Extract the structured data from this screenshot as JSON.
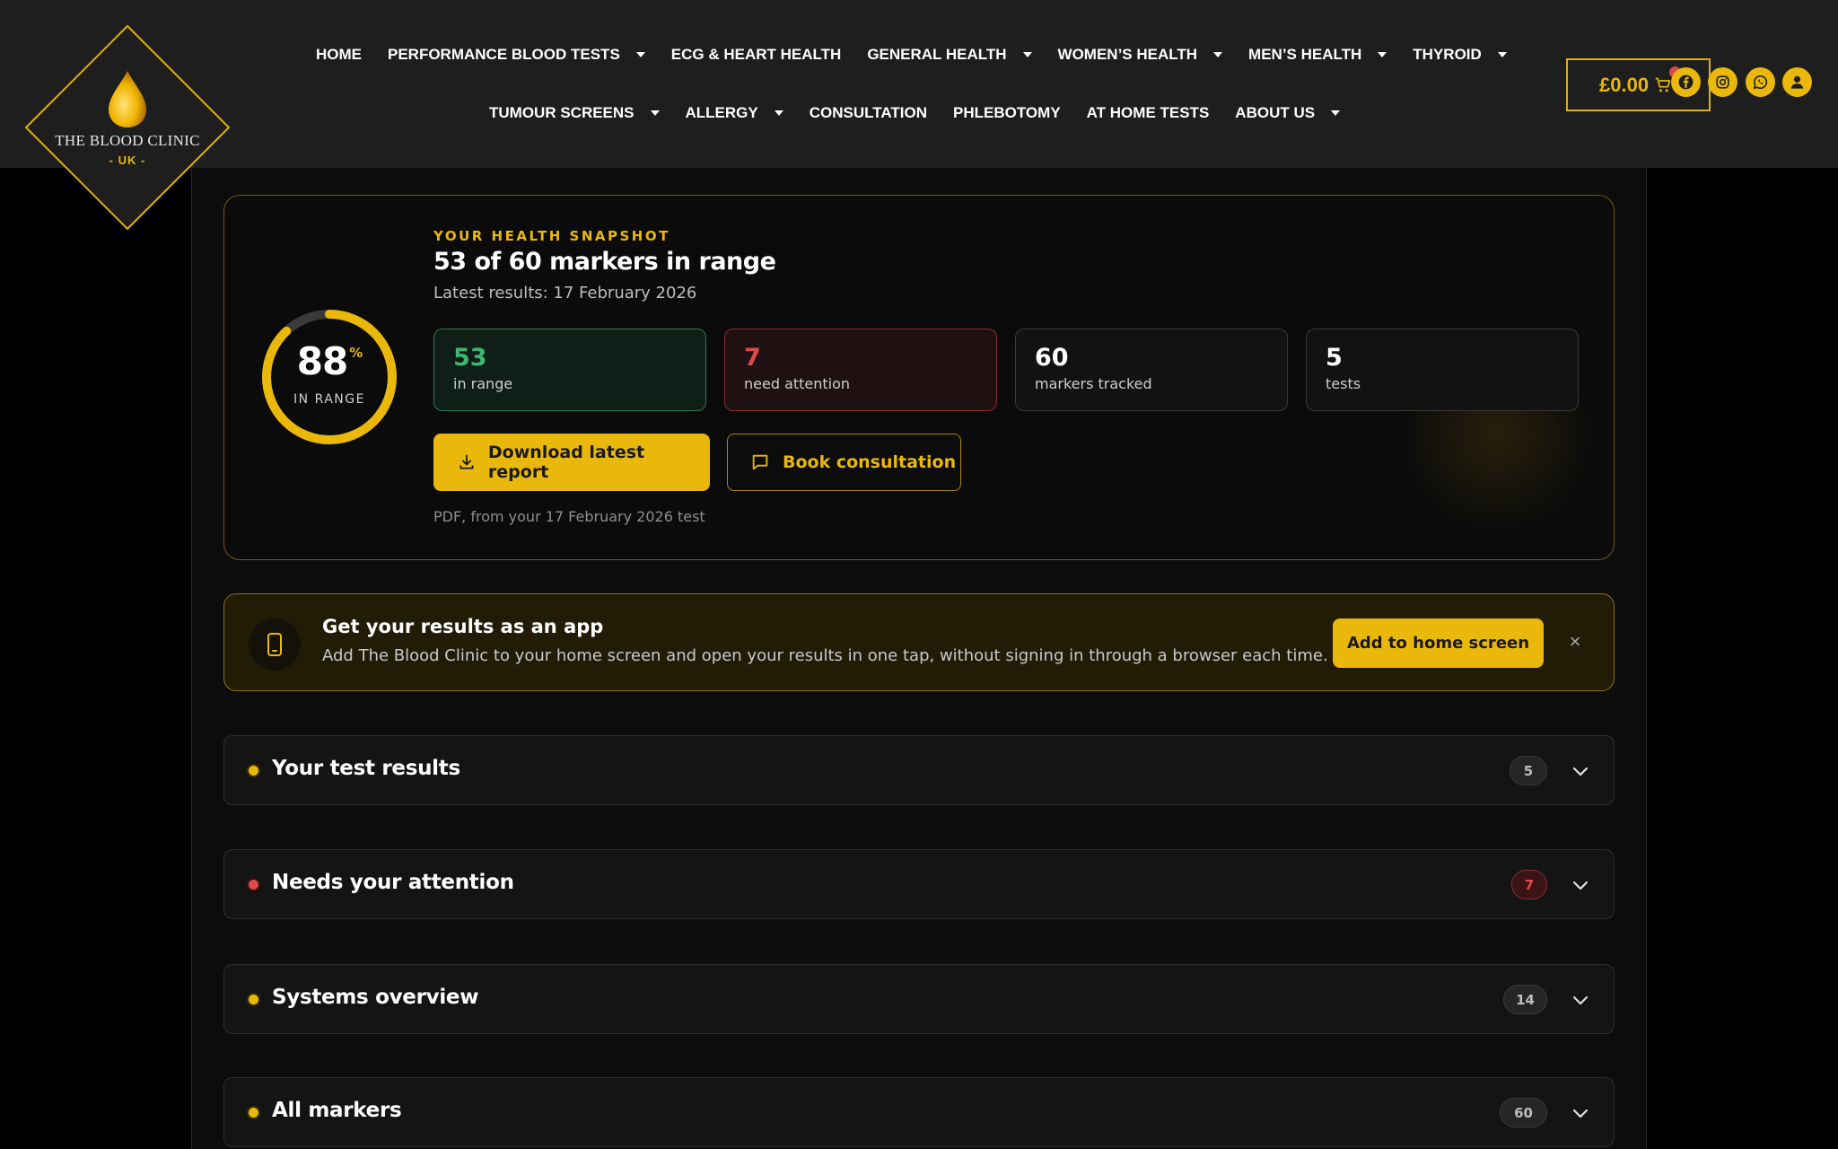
{
  "brand": {
    "name": "THE BLOOD CLINIC",
    "sub": "- UK -"
  },
  "nav": {
    "row1": [
      {
        "label": "HOME",
        "dropdown": false
      },
      {
        "label": "PERFORMANCE BLOOD TESTS",
        "dropdown": true
      },
      {
        "label": "ECG & HEART HEALTH",
        "dropdown": false
      },
      {
        "label": "GENERAL HEALTH",
        "dropdown": true
      },
      {
        "label": "WOMEN’S HEALTH",
        "dropdown": true
      },
      {
        "label": "MEN’S HEALTH",
        "dropdown": true
      },
      {
        "label": "THYROID",
        "dropdown": true
      }
    ],
    "row2": [
      {
        "label": "TUMOUR SCREENS",
        "dropdown": true
      },
      {
        "label": "ALLERGY",
        "dropdown": true
      },
      {
        "label": "CONSULTATION",
        "dropdown": false
      },
      {
        "label": "PHLEBOTOMY",
        "dropdown": false
      },
      {
        "label": "AT HOME TESTS",
        "dropdown": false
      },
      {
        "label": "ABOUT US",
        "dropdown": true
      }
    ]
  },
  "cart": {
    "amount": "£0.00",
    "icon": "cart-icon"
  },
  "social_icons": [
    "facebook-icon",
    "instagram-icon",
    "whatsapp-icon",
    "user-icon"
  ],
  "snapshot": {
    "eyebrow": "YOUR HEALTH SNAPSHOT",
    "title": "53 of 60 markers in range",
    "subtitle": "Latest results: 17 February 2026",
    "ring": {
      "percent": 88,
      "percent_sign": "%",
      "label": "IN RANGE"
    },
    "stats": [
      {
        "value": "53",
        "label": "in range",
        "tone": "green"
      },
      {
        "value": "7",
        "label": "need attention",
        "tone": "red"
      },
      {
        "value": "60",
        "label": "markers tracked",
        "tone": "neutral"
      },
      {
        "value": "5",
        "label": "tests",
        "tone": "neutral"
      }
    ],
    "download_label": "Download latest report",
    "consult_label": "Book consultation",
    "note": "PDF, from your 17 February 2026 test"
  },
  "app_banner": {
    "title": "Get your results as an app",
    "text": "Add The Blood Clinic to your home screen and open your results in one tap, without signing in through a browser each time.",
    "button": "Add to home screen",
    "close": "×"
  },
  "sections": [
    {
      "title": "Your test results",
      "count": "5",
      "tone": "yellow"
    },
    {
      "title": "Needs your attention",
      "count": "7",
      "tone": "red"
    },
    {
      "title": "Systems overview",
      "count": "14",
      "tone": "yellow"
    },
    {
      "title": "All markers",
      "count": "60",
      "tone": "yellow"
    }
  ],
  "colors": {
    "accent": "#e9b80a",
    "header_bg": "#1e1e1f",
    "green": "#3fb56f",
    "red": "#e14a4a"
  }
}
